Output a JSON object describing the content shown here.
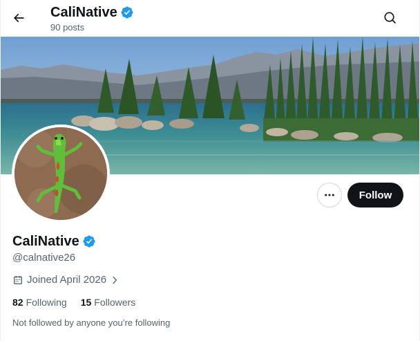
{
  "header": {
    "name": "CaliNative",
    "posts_count": "90 posts",
    "back_icon": "arrow-left-icon",
    "search_icon": "search-icon",
    "verified_icon": "verified-badge-icon"
  },
  "banner": {
    "description_icon": "lake-landscape-banner"
  },
  "avatar": {
    "icon": "gecko-avatar"
  },
  "actions": {
    "more_icon": "more-horizontal-icon",
    "follow_label": "Follow"
  },
  "profile": {
    "name": "CaliNative",
    "handle": "@calnative26",
    "joined": "Joined April 2026",
    "following_count": "82",
    "following_label": "Following",
    "followers_count": "15",
    "followers_label": "Followers",
    "not_followed": "Not followed by anyone you’re following"
  },
  "colors": {
    "accent": "#1d9bf0",
    "text_primary": "#0f1419",
    "text_secondary": "#536471",
    "follow_bg": "#0f1419"
  }
}
